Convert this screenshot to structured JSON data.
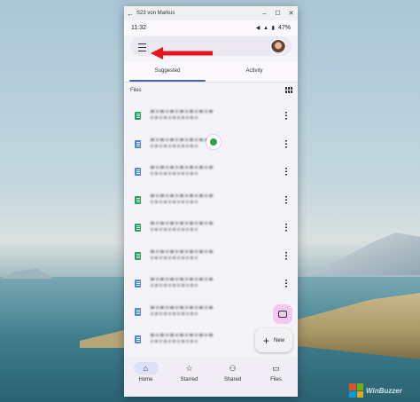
{
  "window": {
    "title": "S23 von Markus",
    "back_glyph": "←",
    "min_glyph": "–",
    "max_glyph": "☐",
    "close_glyph": "✕"
  },
  "status": {
    "time": "11:32",
    "battery": "47%",
    "icons": "◀ ▲ ▮"
  },
  "tabs": [
    {
      "label": "Suggested"
    },
    {
      "label": "Activity"
    }
  ],
  "files_header": "Files",
  "files": [
    {
      "type": "sheet"
    },
    {
      "type": "doc",
      "shared": true
    },
    {
      "type": "doc"
    },
    {
      "type": "sheet"
    },
    {
      "type": "sheet"
    },
    {
      "type": "sheet"
    },
    {
      "type": "doc"
    },
    {
      "type": "doc"
    },
    {
      "type": "doc"
    }
  ],
  "fab_new_label": "New",
  "fab_new_glyph": "+",
  "bottom_nav": [
    {
      "label": "Home",
      "glyph": "⌂"
    },
    {
      "label": "Starred",
      "glyph": "☆"
    },
    {
      "label": "Shared",
      "glyph": "⚇"
    },
    {
      "label": "Files",
      "glyph": "▭"
    }
  ],
  "watermark": "WinBuzzer",
  "colors": {
    "accent": "#5063a7",
    "sheet": "#1fa463",
    "doc": "#4a86e8",
    "arrow": "#e8141b",
    "fab_scan": "#f3c9f1"
  }
}
